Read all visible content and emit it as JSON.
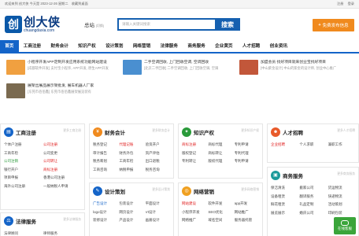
{
  "topbar": {
    "items_left": [
      "欢迎来到 创大侠 今天是 2023-12-26 星期二",
      "",
      "收藏到桌面"
    ],
    "items_right": [
      "注册",
      "登录"
    ]
  },
  "header": {
    "logo_cn": "创大侠",
    "logo_en": "chuangdaxia.com",
    "logo_mark": "创",
    "city": "总站",
    "city_switch": "[切换]",
    "search_placeholder": "请输入关键词搜索",
    "search_button": "搜索",
    "publish_button": "免费发布信息",
    "publish_icon": "+"
  },
  "nav": {
    "items": [
      "首页",
      "工商注册",
      "财务会计",
      "知识产权",
      "设计策划",
      "网络营销",
      "法律服务",
      "商务服务",
      "企业黄页",
      "人才招聘",
      "创业资讯"
    ]
  },
  "promo": [
    {
      "title": "小程序开发APP定制开发应用系统功能网站建设",
      "sub": "[成都软件开发] 支付宝小程序, APP开发, 原生APP开发",
      "color": "#f0a040"
    },
    {
      "title": "二手空调回收, 上门回收空调, 空调回收",
      "sub": "[北京二手回收] 二手空调回收, 上门回收空调, 空调",
      "color": "#4a8fd0"
    },
    {
      "title": "加盟会员 找好项目就来创业宝找好项目",
      "sub": "[中山紫金设计] 中山的紫金的设计师, 创业中心推广",
      "color": "#c2573a"
    },
    {
      "title": "展架出展品展示架批发, 展车机器人厂家",
      "sub": "[东莞市佰佰鑫] 东莞市佰佰鑫展架展览装有",
      "color": "#7a6a50"
    }
  ],
  "cards": {
    "gongshang": {
      "title": "工商注册",
      "more": "更多工商注册",
      "icon": "doc-icon",
      "links": [
        "个体户注册",
        "公司注册",
        "工商年检",
        "公司变更",
        "公司注销",
        "公司转让",
        "银行开户",
        "商标注册",
        "项目申报",
        "香港公司注册",
        "海外公司注册",
        "一般纳税人申请"
      ]
    },
    "caiwu": {
      "title": "财务会计",
      "more": "更多财务会计",
      "icon": "money-icon",
      "links": [
        "税务登记",
        "代理记账",
        "验资开户",
        "审计报告",
        "财务外包",
        "资产评估",
        "税务筹划",
        "工商年检",
        "出口退税",
        "工商咨询",
        "纳税申报",
        "税务咨询"
      ]
    },
    "zhishi": {
      "title": "知识产权",
      "more": "更多知识产权",
      "icon": "bulb-icon",
      "links": [
        "商标注册",
        "商标代理",
        "专利申请",
        "版权登记",
        "商标转让",
        "专利代理",
        "专利转让",
        "版权代理",
        "专利申请",
        "商标设计"
      ]
    },
    "rencai": {
      "title": "人才招聘",
      "more": "更多人才招聘",
      "icon": "person-icon",
      "links": [
        "企业招聘",
        "个人求职",
        "兼职工作"
      ]
    },
    "sheji": {
      "title": "设计策划",
      "more": "更多设计策划",
      "icon": "pen-icon",
      "links": [
        "广告设计",
        "包装设计",
        "平面设计",
        "logo设计",
        "网页设计",
        "VI设计",
        "装修设计",
        "产品设计",
        "画册设计",
        "CI设计",
        "建筑设计",
        "动画设计"
      ]
    },
    "wangluo": {
      "title": "网络营销",
      "more": "更多网络营销",
      "icon": "globe-icon",
      "links": [
        "网站建设",
        "软件开发",
        "app开发",
        "小程序开发",
        "SEO优化",
        "网站推广",
        "网络推广",
        "域名空间",
        "服务器托管",
        "微信开发",
        "网络营销",
        "企业建站"
      ]
    },
    "shangwu": {
      "title": "商务服务",
      "more": "更多商务服务",
      "icon": "case-icon",
      "links": [
        "保洁清洗",
        "搬家公司",
        "货运物流",
        "设备租赁",
        "翻译服务",
        "快递物流",
        "鲜花租赁",
        "礼品定制",
        "活动策划",
        "展览展示",
        "婚庆公司",
        "印刷包装"
      ]
    },
    "falv": {
      "title": "法律服务",
      "more": "更多法律服务",
      "icon": "scale-icon",
      "links": [
        "法律顾问",
        "律师服务"
      ]
    }
  },
  "chat": {
    "label": "在线客服"
  },
  "colors": {
    "brand": "#1464c8",
    "accent": "#f08a1e",
    "red": "#e02020"
  }
}
